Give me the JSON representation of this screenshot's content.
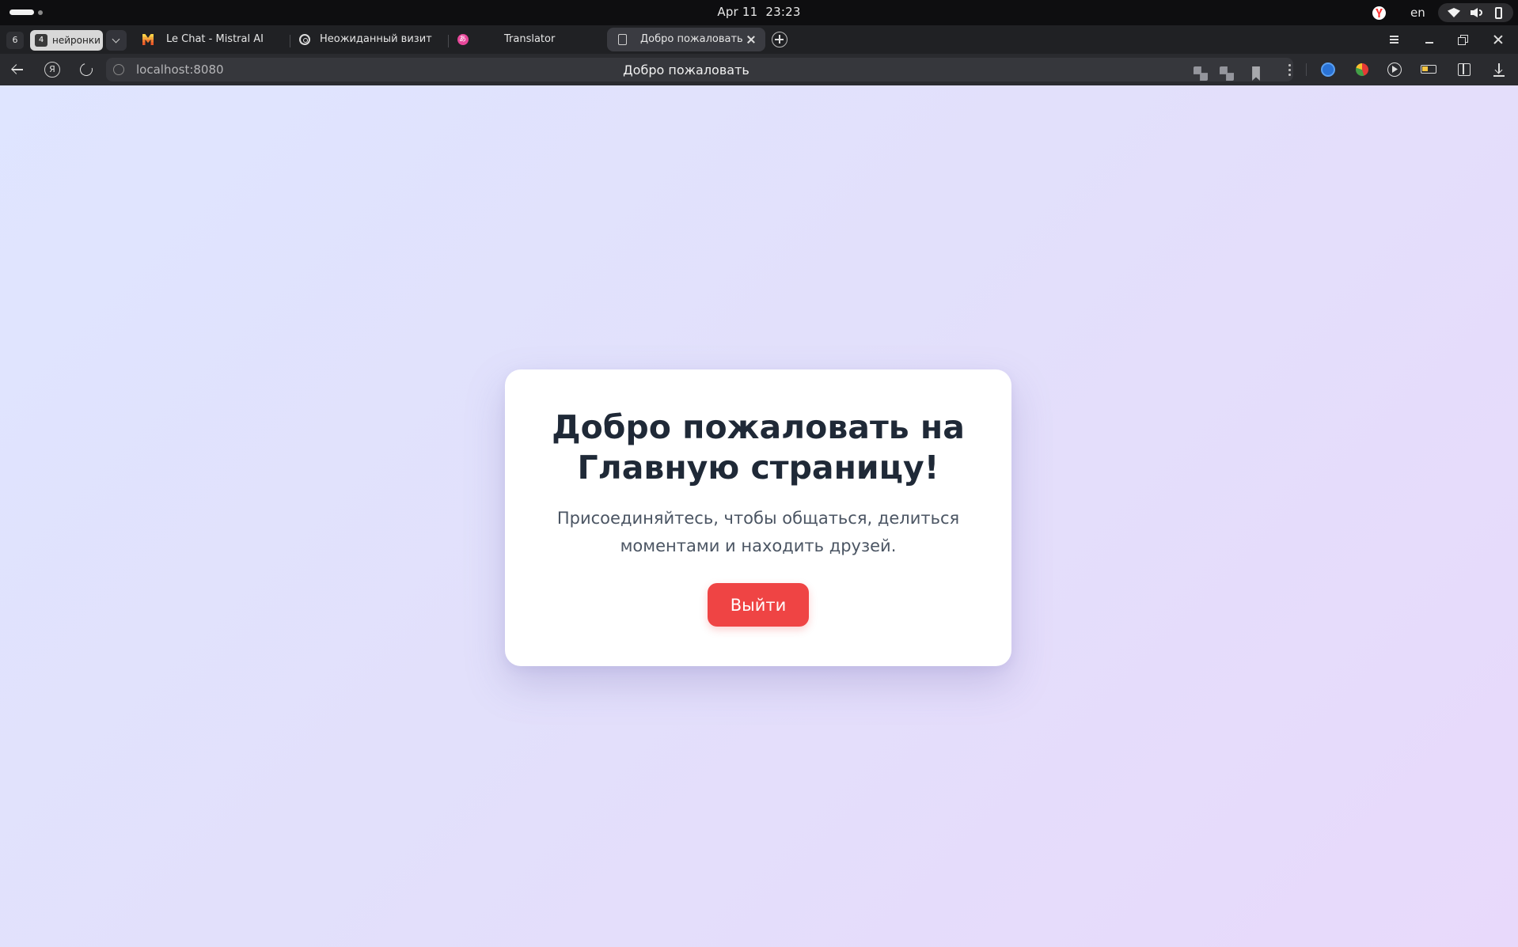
{
  "os": {
    "date": "Apr 11",
    "time": "23:23",
    "language": "en",
    "tray_icons": [
      "yandex-browser-icon",
      "wifi-icon",
      "volume-icon",
      "battery-icon"
    ]
  },
  "tabstrip": {
    "tab_count": "6",
    "group": {
      "count": "4",
      "name": "нейронки"
    },
    "tabs": [
      {
        "title": "Le Chat - Mistral AI",
        "icon": "mistral-icon"
      },
      {
        "title": "Неожиданный визит",
        "icon": "openai-icon"
      },
      {
        "title": "Translator",
        "icon": "translator-icon"
      },
      {
        "title": "Добро пожаловать",
        "icon": "document-icon",
        "active": true
      }
    ]
  },
  "addressbar": {
    "url": "localhost:8080",
    "page_title": "Добро пожаловать"
  },
  "page": {
    "title": "Добро пожаловать на Главную страницу!",
    "subtitle": "Присоединяйтесь, чтобы общаться, делиться моментами и находить друзей.",
    "logout_label": "Выйти",
    "colors": {
      "background_start": "#dfe5ff",
      "background_end": "#e8d9fb",
      "card": "#ffffff",
      "title": "#1f2937",
      "subtitle": "#4b5563",
      "button": "#ef4444"
    }
  }
}
